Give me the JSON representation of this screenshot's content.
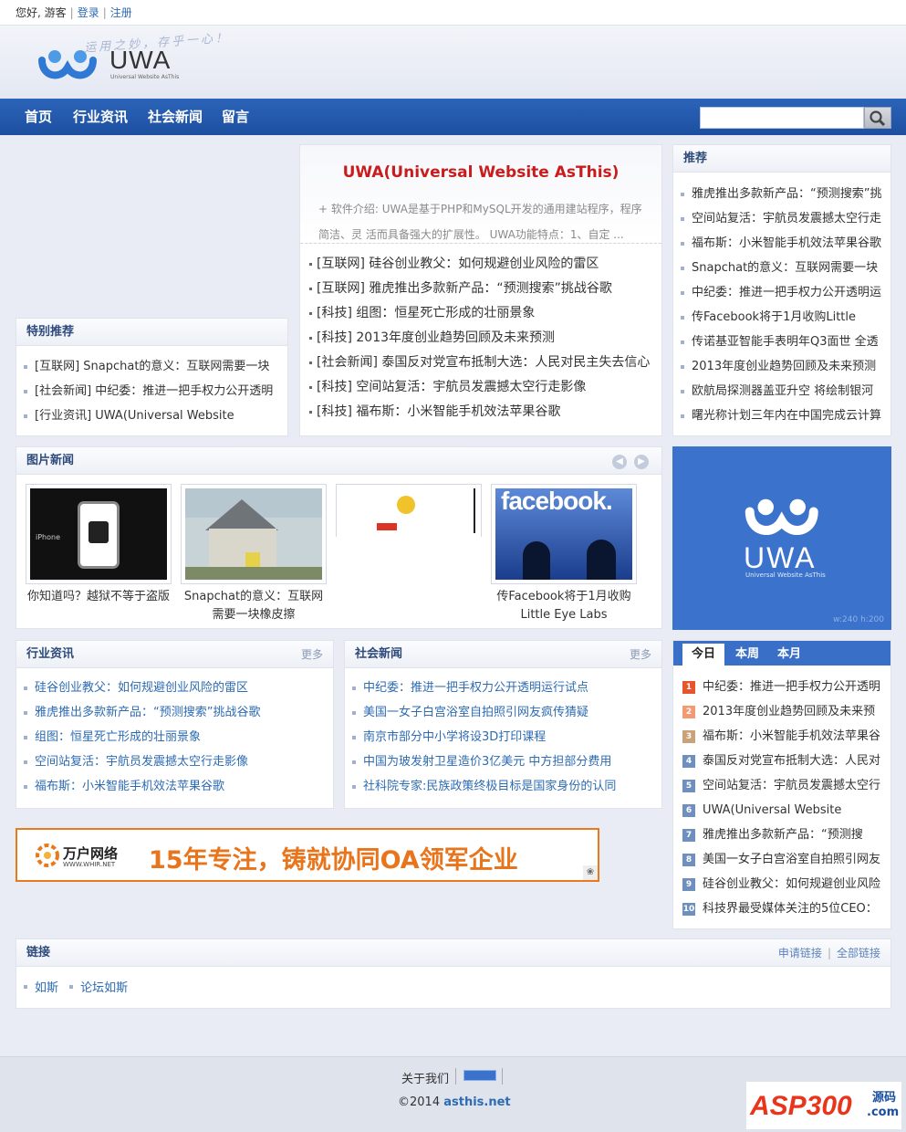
{
  "topbar": {
    "greeting": "您好, 游客",
    "login": "登录",
    "register": "注册"
  },
  "header": {
    "logo_text": "UWA",
    "logo_sub": "Universal Website AsThis",
    "slogan": "运用之妙，存乎一心！"
  },
  "nav": {
    "items": [
      "首页",
      "行业资讯",
      "社会新闻",
      "留言"
    ],
    "search_placeholder": ""
  },
  "special": {
    "title": "特别推荐",
    "items": [
      "[互联网] Snapchat的意义：互联网需要一块",
      "[社会新闻] 中纪委：推进一把手权力公开透明",
      "[行业资讯] UWA(Universal Website"
    ]
  },
  "feature": {
    "title": "UWA(Universal Website AsThis)",
    "desc": "+ 软件介绍: UWA是基于PHP和MySQL开发的通用建站程序，程序简洁、灵 活而具备强大的扩展性。 UWA功能特点：1、自定 ...",
    "items": [
      "[互联网] 硅谷创业教父：如何规避创业风险的雷区",
      "[互联网] 雅虎推出多款新产品：“预测搜索”挑战谷歌",
      "[科技] 组图：恒星死亡形成的壮丽景象",
      "[科技] 2013年度创业趋势回顾及未来预测",
      "[社会新闻] 泰国反对党宣布抵制大选：人民对民主失去信心",
      "[科技] 空间站复活：宇航员发震撼太空行走影像",
      "[科技] 福布斯：小米智能手机效法苹果谷歌"
    ]
  },
  "recommend": {
    "title": "推荐",
    "items": [
      "雅虎推出多款新产品：“预测搜索”挑",
      "空间站复活：宇航员发震撼太空行走",
      "福布斯：小米智能手机效法苹果谷歌",
      "Snapchat的意义：互联网需要一块",
      "中纪委：推进一把手权力公开透明运",
      "传Facebook将于1月收购Little",
      "传诺基亚智能手表明年Q3面世 全透",
      "2013年度创业趋势回顾及未来预测",
      "欧航局探测器盖亚升空 将绘制银河",
      "曙光称计划三年内在中国完成云计算"
    ]
  },
  "pic_news": {
    "title": "图片新闻",
    "items": [
      {
        "caption": "你知道吗？越狱不等于盗版",
        "img_label": "iPhone"
      },
      {
        "caption": "Snapchat的意义：互联网需要一块橡皮擦",
        "img_label": ""
      },
      {
        "caption": "",
        "img_label": ""
      },
      {
        "caption": "传Facebook将于1月收购Little Eye Labs",
        "img_label": "facebook."
      }
    ]
  },
  "ad_uwa": {
    "logo_text": "UWA",
    "logo_sub": "Universal Website AsThis",
    "size": "w:240 h:200"
  },
  "industry": {
    "title": "行业资讯",
    "more": "更多",
    "items": [
      "硅谷创业教父：如何规避创业风险的雷区",
      "雅虎推出多款新产品：“预测搜索”挑战谷歌",
      "组图：恒星死亡形成的壮丽景象",
      "空间站复活：宇航员发震撼太空行走影像",
      "福布斯：小米智能手机效法苹果谷歌"
    ]
  },
  "social": {
    "title": "社会新闻",
    "more": "更多",
    "items": [
      "中纪委：推进一把手权力公开透明运行试点",
      "美国一女子白宫浴室自拍照引网友疯传猜疑",
      "南京市部分中小学将设3D打印课程",
      "中国为玻发射卫星造价3亿美元 中方担部分费用",
      "社科院专家:民族政策终极目标是国家身份的认同"
    ]
  },
  "ranking": {
    "tabs": [
      "今日",
      "本周",
      "本月"
    ],
    "items": [
      "中纪委：推进一把手权力公开透明",
      "2013年度创业趋势回顾及未来预",
      "福布斯：小米智能手机效法苹果谷",
      "泰国反对党宣布抵制大选：人民对",
      "空间站复活：宇航员发震撼太空行",
      "UWA(Universal Website",
      "雅虎推出多款新产品：“预测搜",
      "美国一女子白宫浴室自拍照引网友",
      "硅谷创业教父：如何规避创业风险",
      "科技界最受媒体关注的5位CEO："
    ],
    "colors": [
      "#e8542b",
      "#f39a72",
      "#c9a27a",
      "#6f8fbf",
      "#6f8fbf",
      "#6f8fbf",
      "#6f8fbf",
      "#6f8fbf",
      "#6f8fbf",
      "#6f8fbf"
    ]
  },
  "banner": {
    "brand": "万户网络",
    "brand_url": "WWW.WHIR.NET",
    "slogan": "15年专注，铸就协同OA领军企业"
  },
  "links": {
    "title": "链接",
    "apply": "申请链接",
    "all": "全部链接",
    "items": [
      "如斯",
      "论坛如斯"
    ]
  },
  "footer": {
    "about": "关于我们",
    "copyright_prefix": "©2014",
    "domain": "asthis.net"
  },
  "watermark": {
    "text": "ASP300",
    "sub": "源码",
    "dot": ".com"
  },
  "colors": {
    "nav": "#2c64b9",
    "accent_red": "#c91c1c",
    "link": "#2d6bb3",
    "banner_border": "#e87a1b"
  }
}
